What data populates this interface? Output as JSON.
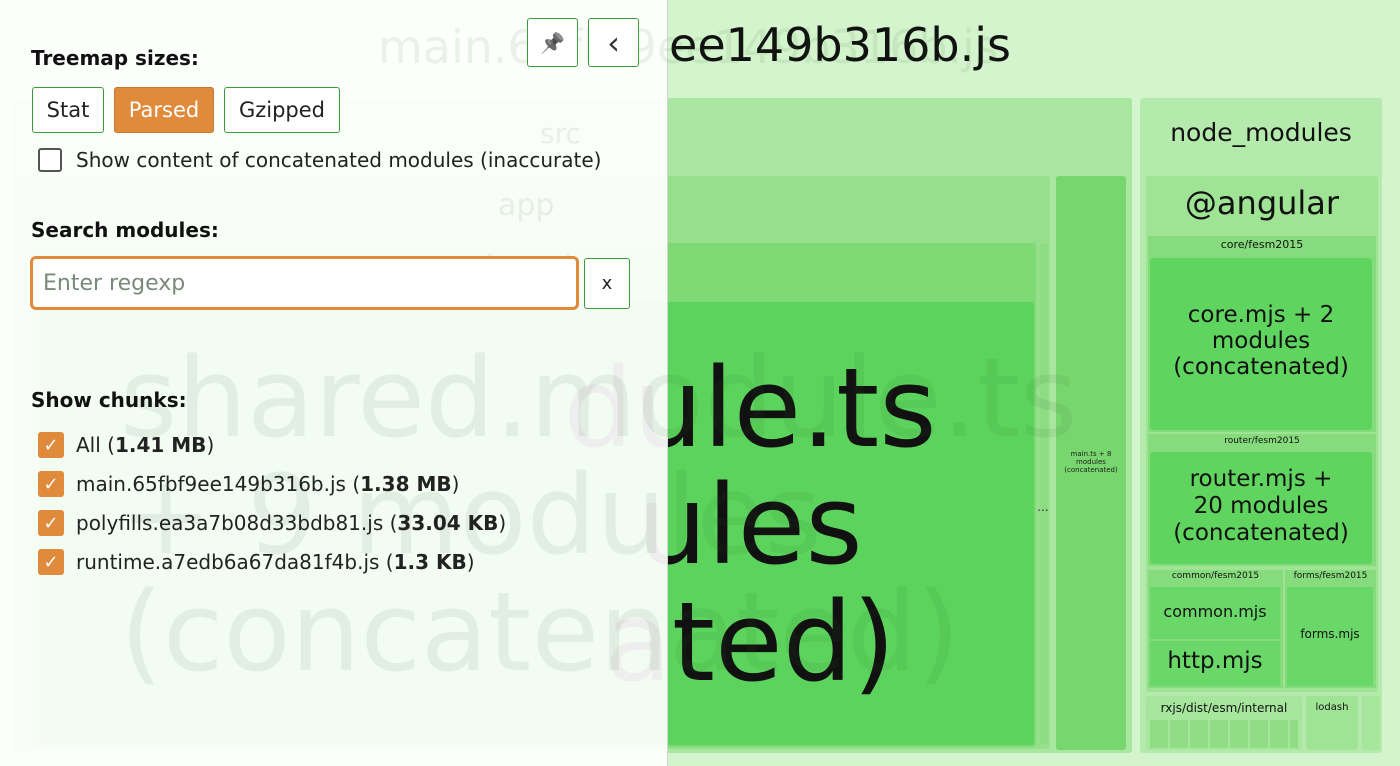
{
  "treemap": {
    "main_chunk": "main.65fbf9ee149b316b.js",
    "main_chunk_visible": "ee149b316b.js",
    "src": "src",
    "app": "app",
    "shared": "shared",
    "shared_module": "shared.module.ts\n+ 9 modules\n(concatenated)",
    "shared_module_visible": "dule.ts\nules\nated)",
    "ellipsis": "...",
    "main_ts": "main.ts + 8\nmodules\n(concatenated)",
    "node_modules": "node_modules",
    "angular": "@angular",
    "core_dir": "core/fesm2015",
    "core_mjs": "core.mjs + 2\nmodules\n(concatenated)",
    "router_dir": "router/fesm2015",
    "router_mjs": "router.mjs +\n20 modules\n(concatenated)",
    "common_dir": "common/fesm2015",
    "common_mjs": "common.mjs",
    "http_mjs": "http.mjs",
    "forms_dir": "forms/fesm2015",
    "forms_mjs": "forms.mjs",
    "rxjs": "rxjs/dist/esm/internal",
    "lodash": "lodash"
  },
  "sidebar": {
    "pin_icon": "pin-icon",
    "collapse_icon": "chevron-left-icon",
    "pin_symbol": "📌",
    "collapse_symbol": "‹",
    "treemap_sizes_title": "Treemap sizes:",
    "size_buttons": [
      "Stat",
      "Parsed",
      "Gzipped"
    ],
    "active_size": "Parsed",
    "show_concat_label": "Show content of concatenated modules (inaccurate)",
    "search_title": "Search modules:",
    "search_placeholder": "Enter regexp",
    "search_value": "",
    "clear_label": "x",
    "chunks_title": "Show chunks:",
    "chunks": [
      {
        "name": "All",
        "size": "1.41 MB",
        "checked": true
      },
      {
        "name": "main.65fbf9ee149b316b.js",
        "size": "1.38 MB",
        "checked": true
      },
      {
        "name": "polyfills.ea3a7b08d33bdb81.js",
        "size": "33.04 KB",
        "checked": true
      },
      {
        "name": "runtime.a7edb6a67da81f4b.js",
        "size": "1.3 KB",
        "checked": true
      }
    ],
    "check_mark": "✓"
  },
  "colors": {
    "accent": "#e08a3c",
    "treemap_green": "#5bd35c",
    "button_border": "#3a9d3a"
  }
}
